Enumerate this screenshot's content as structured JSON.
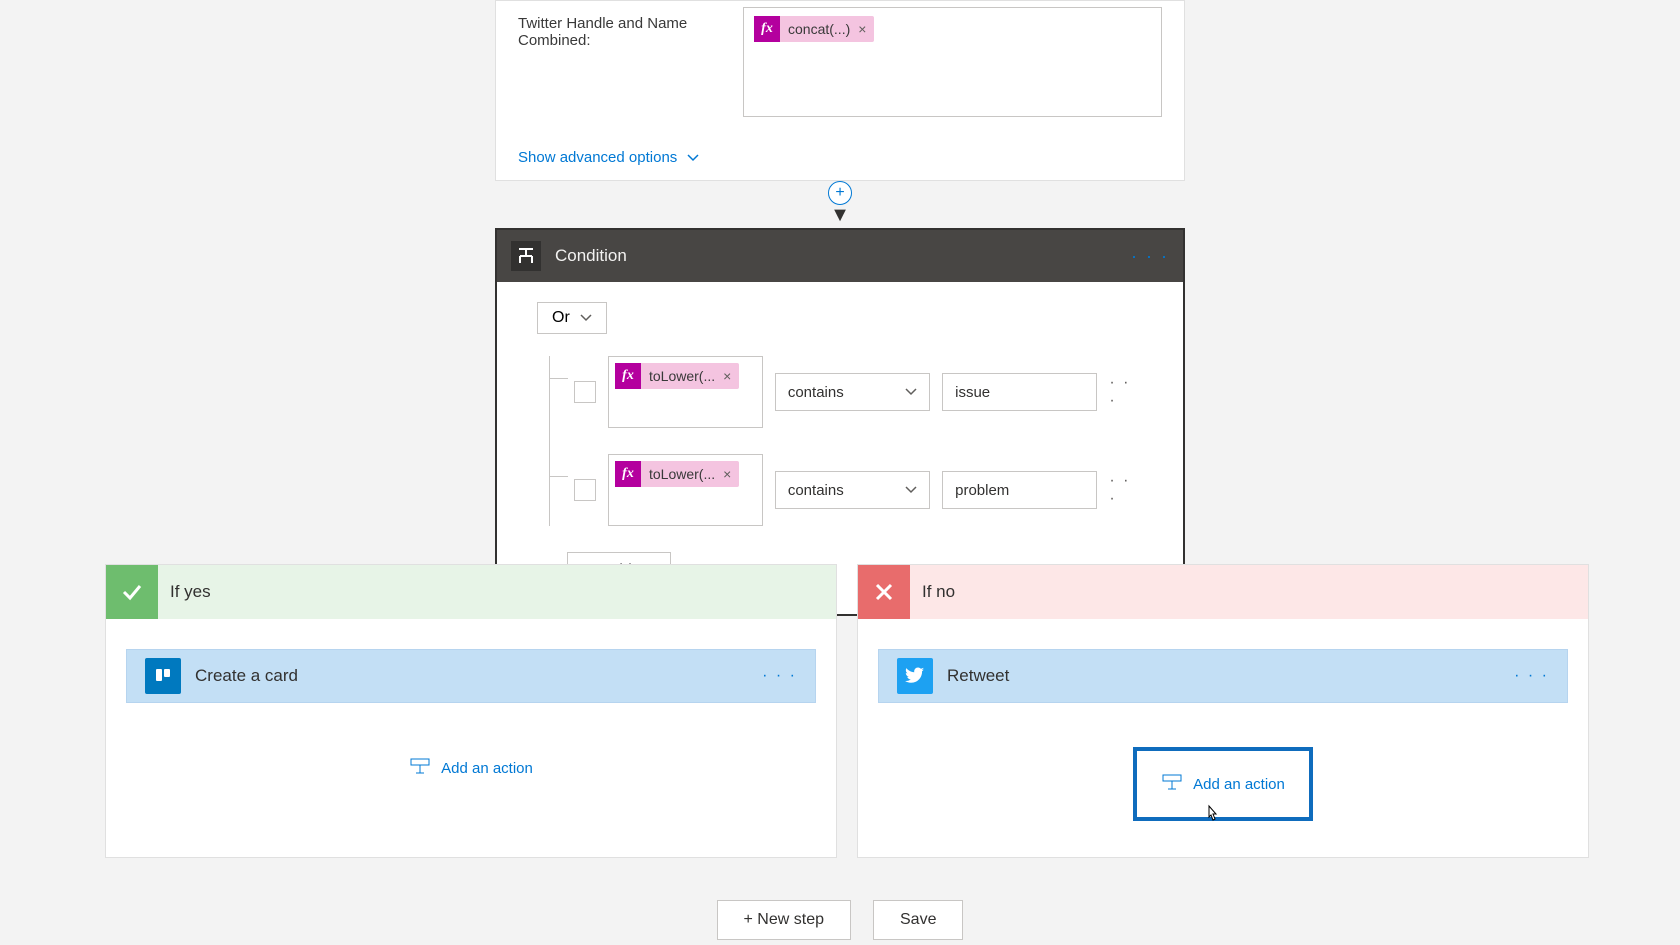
{
  "top": {
    "field_label": "Twitter Handle and Name Combined:",
    "pill_label": "concat(...)",
    "advanced": "Show advanced options"
  },
  "condition": {
    "title": "Condition",
    "group_op": "Or",
    "rows": [
      {
        "value_pill": "toLower(...",
        "op": "contains",
        "compare": "issue"
      },
      {
        "value_pill": "toLower(...",
        "op": "contains",
        "compare": "problem"
      }
    ],
    "add_label": "Add"
  },
  "branches": {
    "yes": {
      "title": "If yes",
      "action": "Create a card",
      "add_action": "Add an action"
    },
    "no": {
      "title": "If no",
      "action": "Retweet",
      "add_action": "Add an action"
    }
  },
  "buttons": {
    "new_step": "+ New step",
    "save": "Save"
  }
}
